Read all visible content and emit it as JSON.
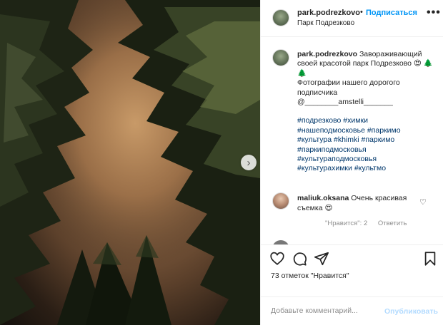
{
  "post": {
    "username": "park.podrezkovo",
    "separator": "•",
    "follow_label": "Подписаться",
    "location": "Парк Подрезково",
    "more": "•••"
  },
  "caption": {
    "username": "park.podrezkovo",
    "text": "Завораживающий своей красотой парк Подрезково 😍 🌲🌲",
    "text2": "Фотографии нашего дорогого подписчика @________amstelli_______",
    "hashtags": [
      "#подрезково",
      "#химки",
      "#нашеподмосковье",
      "#паркимо",
      "#культура",
      "#khimki",
      "#паркимо",
      "#паркиподмосковья",
      "#культураподмосковья",
      "#культурахимки",
      "#культмо"
    ]
  },
  "comment": {
    "username": "maliuk.oksana",
    "text": "Очень красивая съемка 😍",
    "likes_label": "\"Нравится\": 2",
    "reply_label": "Ответить",
    "like_icon": "heart-outline-icon"
  },
  "actions": {
    "like_icon": "heart-outline-icon",
    "comment_icon": "comment-bubble-icon",
    "share_icon": "paper-plane-icon",
    "save_icon": "bookmark-icon",
    "likes_text": "73 отметок \"Нравится\""
  },
  "add_comment": {
    "placeholder": "Добавьте комментарий...",
    "publish_label": "Опубликовать"
  },
  "carousel": {
    "next_icon": "chevron-right-icon",
    "glyph": "›"
  },
  "colors": {
    "accent": "#0095f6",
    "text": "#262626",
    "muted": "#8e8e8e",
    "publish_disabled": "#b3dbff",
    "hashtag": "#00376b"
  }
}
